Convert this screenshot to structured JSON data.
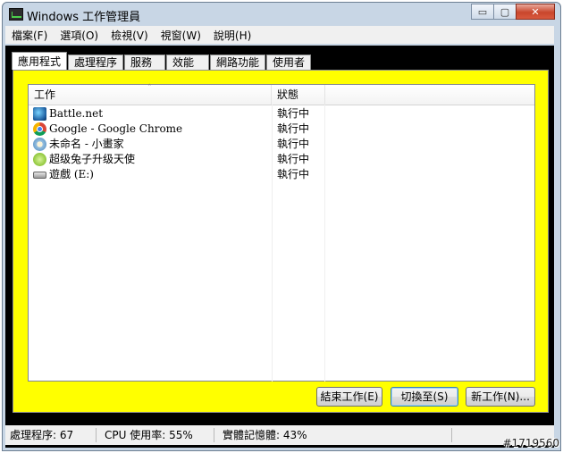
{
  "window": {
    "title": "Windows 工作管理員",
    "caption_buttons": {
      "minimize": "▭",
      "restore": "▢",
      "close": "✕"
    }
  },
  "menu": [
    "檔案(F)",
    "選項(O)",
    "檢視(V)",
    "視窗(W)",
    "說明(H)"
  ],
  "tabs": [
    {
      "label": "應用程式",
      "active": true
    },
    {
      "label": "處理程序",
      "active": false
    },
    {
      "label": "服務",
      "active": false
    },
    {
      "label": "效能",
      "active": false
    },
    {
      "label": "網路功能",
      "active": false
    },
    {
      "label": "使用者",
      "active": false
    }
  ],
  "list": {
    "columns": {
      "task": "工作",
      "status": "狀態"
    },
    "sort_indicator": "ˆ",
    "rows": [
      {
        "name": "Battle.net",
        "status": "執行中",
        "icon": "battlenet-icon"
      },
      {
        "name": "Google - Google Chrome",
        "status": "執行中",
        "icon": "chrome-icon"
      },
      {
        "name": "未命名 - 小畫家",
        "status": "執行中",
        "icon": "paint-icon"
      },
      {
        "name": "超级兔子升级天使",
        "status": "執行中",
        "icon": "rabbit-icon"
      },
      {
        "name": "遊戲 (E:)",
        "status": "執行中",
        "icon": "drive-icon"
      }
    ]
  },
  "buttons": {
    "end_task": "結束工作(E)",
    "switch_to": "切換至(S)",
    "new_task": "新工作(N)..."
  },
  "status_bar": {
    "processes": "處理程序: 67",
    "cpu": "CPU 使用率: 55%",
    "memory": "實體記憶體: 43%"
  },
  "colors": {
    "panel_background": "#ffff00",
    "client_background": "#000000"
  },
  "watermark": "#1719560"
}
